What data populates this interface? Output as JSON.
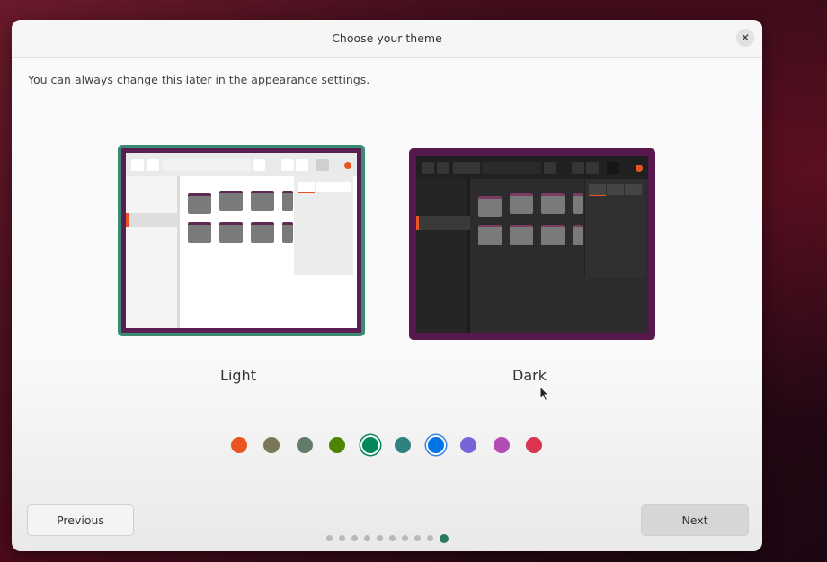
{
  "dialog": {
    "title": "Choose your theme",
    "subtitle": "You can always change this later in the appearance settings."
  },
  "themes": [
    {
      "label": "Light",
      "selected": true
    },
    {
      "label": "Dark",
      "selected": false
    }
  ],
  "accent_colors": [
    {
      "name": "orange",
      "hex": "#e95420",
      "selected": false
    },
    {
      "name": "bark",
      "hex": "#787859",
      "selected": false
    },
    {
      "name": "sage",
      "hex": "#657b69",
      "selected": false
    },
    {
      "name": "olive",
      "hex": "#4b8501",
      "selected": false
    },
    {
      "name": "viridian",
      "hex": "#03875b",
      "selected": true
    },
    {
      "name": "prussian-green",
      "hex": "#308280",
      "selected": false
    },
    {
      "name": "blue",
      "hex": "#0073e5",
      "selected": false
    },
    {
      "name": "purple",
      "hex": "#7764d8",
      "selected": false
    },
    {
      "name": "magenta",
      "hex": "#b34cb3",
      "selected": false
    },
    {
      "name": "red",
      "hex": "#da3450",
      "selected": false
    }
  ],
  "buttons": {
    "previous": "Previous",
    "next": "Next"
  },
  "pagination": {
    "total": 10,
    "current": 10
  },
  "colors": {
    "selection_border": "#3a8a74",
    "pager_active": "#2c7a5e"
  }
}
